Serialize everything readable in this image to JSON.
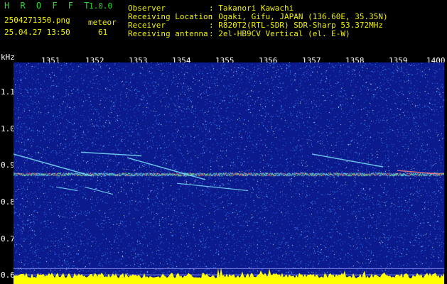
{
  "header": {
    "app_name": "H R O F F T",
    "version": "1.0.0",
    "file_name": "2504271350.png",
    "meteor_label": "meteor",
    "datetime": "25.04.27 13:50",
    "meteor_count": "61",
    "info": [
      {
        "label": "Observer",
        "value": ": Takanori Kawachi"
      },
      {
        "label": "Receiving Location",
        "value": ": Ogaki, Gifu, JAPAN (136.60E, 35.35N)"
      },
      {
        "label": "Receiver",
        "value": ": R820T2(RTL-SDR) SDR-Sharp 53.372MHz"
      },
      {
        "label": "Receiving antenna",
        "value": ": 2el-HB9CV Vertical (el. E-W)"
      }
    ]
  },
  "chart_data": {
    "type": "heatmap",
    "ylabel": "kHz",
    "x_ticks": [
      "1351",
      "1352",
      "1353",
      "1354",
      "1355",
      "1356",
      "1357",
      "1358",
      "1359",
      "1400"
    ],
    "y_ticks": [
      "1.1",
      "1.0",
      "0.9",
      "0.8",
      "0.7",
      "0.6"
    ],
    "ylim": [
      0.575,
      1.18
    ],
    "colors": {
      "background": "#0b1a8c",
      "noise": "#3a8cff",
      "signal": "#ff3a3a",
      "level": "#ffff00"
    }
  }
}
